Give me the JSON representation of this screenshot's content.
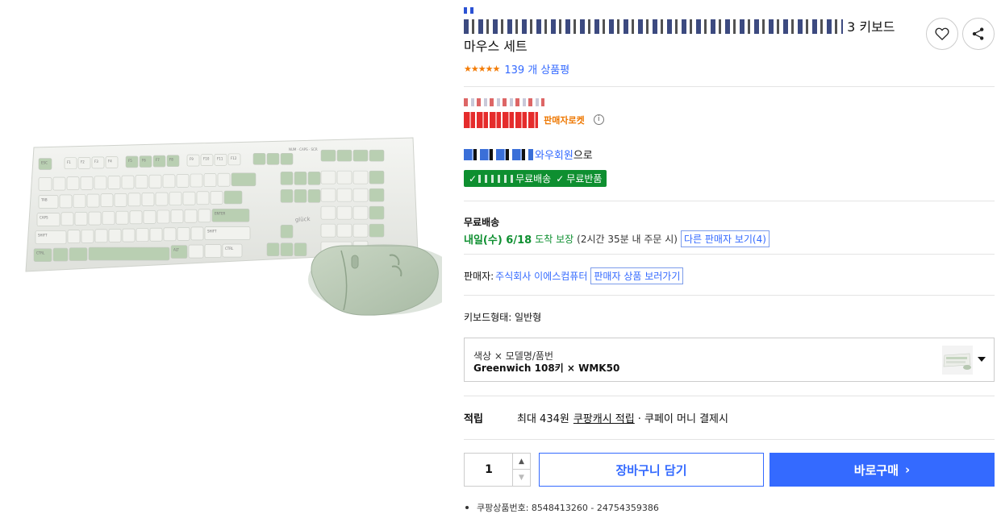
{
  "product": {
    "title_suffix": "3 키보드",
    "title_line2": "마우스 세트",
    "review_count": "139 개 상품평",
    "rocket_label": "판매자로켓",
    "wow_text": "와우회원",
    "wow_suffix": "으로",
    "free_shipping_badge": "무료배송",
    "free_return_badge": "무료반품",
    "check_mark": "✓"
  },
  "shipping": {
    "title": "무료배송",
    "date": "내일(수) 6/18",
    "guarantee": "도착 보장",
    "condition": "(2시간 35분 내 주문 시)",
    "other_sellers": "다른 판매자 보기(4)"
  },
  "seller": {
    "label": "판매자:",
    "name": "주식회사 이에스컴퓨터",
    "products_button": "판매자 상품 보러가기"
  },
  "keyboard_type": "키보드형태: 일반형",
  "option": {
    "label": "색상 × 모델명/품번",
    "value": "Greenwich 108키 × WMK50"
  },
  "points": {
    "label": "적립",
    "max": "최대 434원",
    "cash_link": "쿠팡캐시 적립",
    "tail": "· 쿠페이 머니 결제시"
  },
  "purchase": {
    "quantity": "1",
    "cart_button": "장바구니 담기",
    "buy_button": "바로구매",
    "buy_chevron": "›"
  },
  "product_id": "쿠팡상품번호: 8548413260 - 24754359386",
  "keyboard_branding": "glück",
  "keycaps": {
    "top_row": [
      "ESC",
      "F1",
      "F2",
      "F3",
      "F4",
      "F5",
      "F6",
      "F7",
      "F8",
      "F9",
      "F10",
      "F11",
      "F12"
    ],
    "enter": "ENTER",
    "shift": "SHIFT",
    "caps": "CAPS",
    "tab": "TAB",
    "ctrl": "CTRL",
    "alt": "ALT"
  },
  "colors": {
    "accent": "#346aff",
    "green": "#0e8f30",
    "sale_red": "#e52c2c",
    "rocket_orange": "#ee7700",
    "keyboard_mint": "#b9cfb2",
    "keyboard_white": "#f1f2ee"
  }
}
